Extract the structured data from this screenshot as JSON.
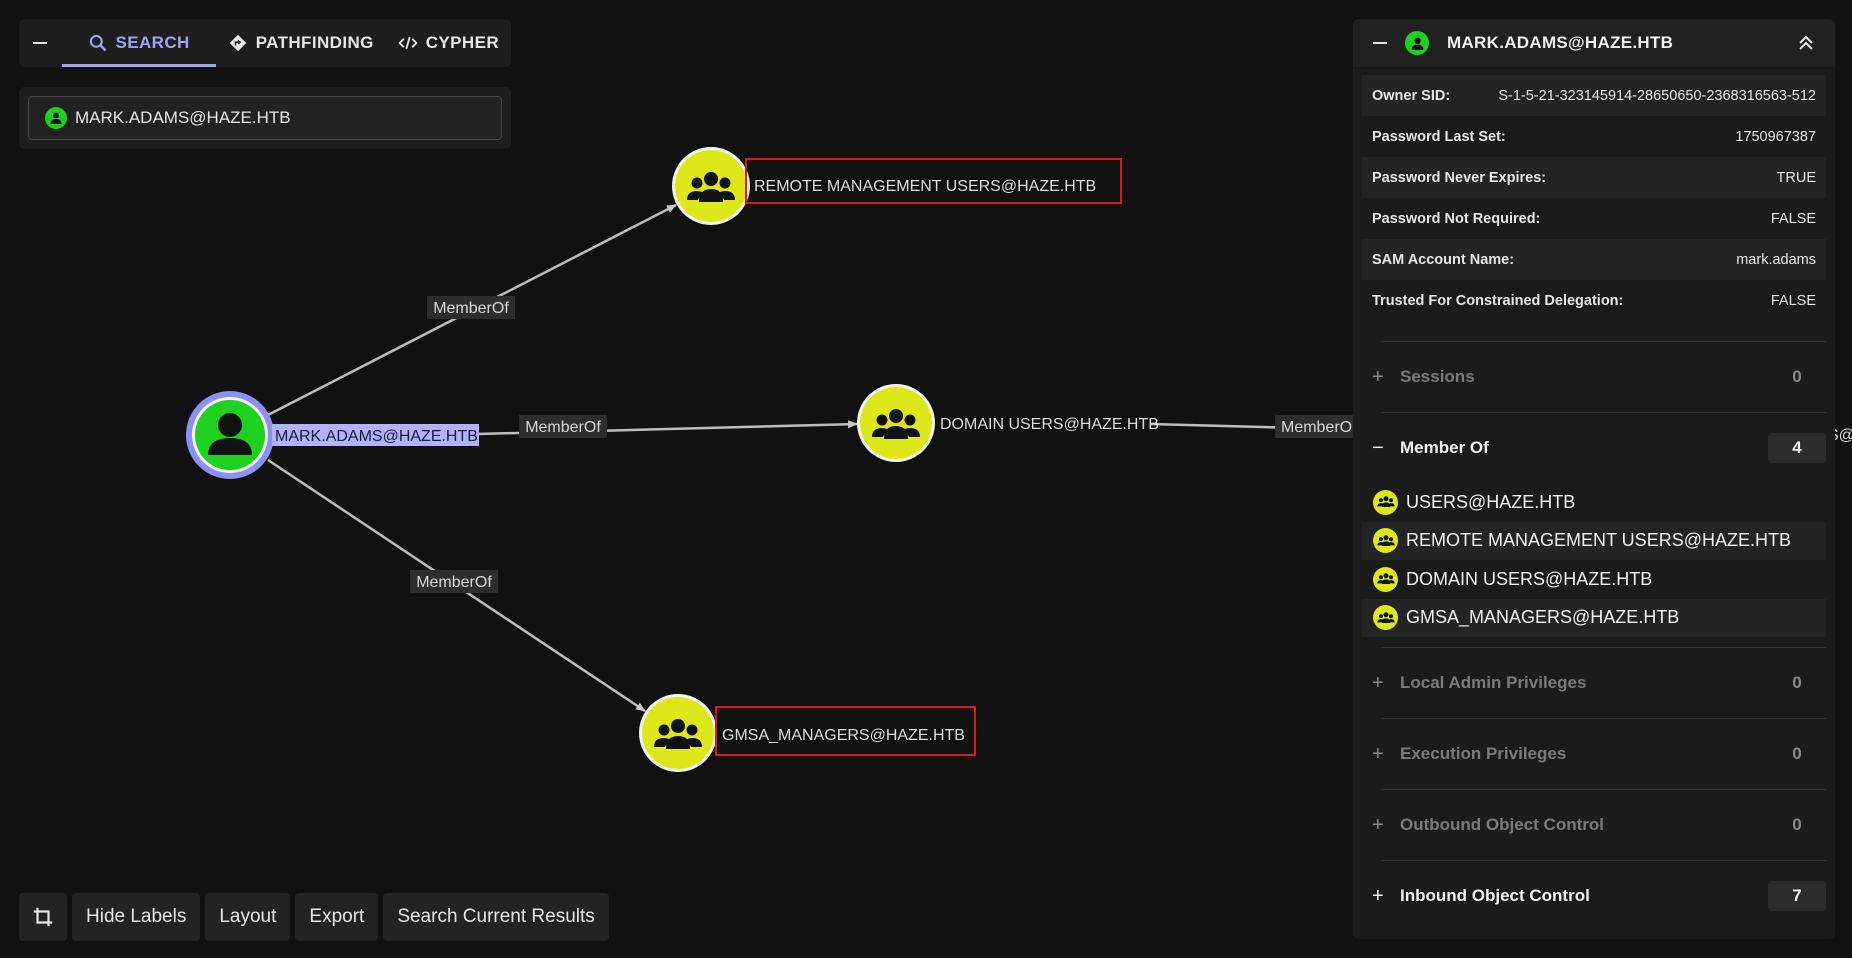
{
  "search_panel": {
    "tabs": [
      {
        "label": "SEARCH",
        "icon": "search-icon",
        "active": true
      },
      {
        "label": "PATHFINDING",
        "icon": "diamond-route-icon",
        "active": false
      },
      {
        "label": "CYPHER",
        "icon": "code-icon",
        "active": false
      }
    ],
    "selected_node": "MARK.ADAMS@HAZE.HTB"
  },
  "graph": {
    "nodes": {
      "user": "MARK.ADAMS@HAZE.HTB",
      "remote": "REMOTE MANAGEMENT USERS@HAZE.HTB",
      "domain": "DOMAIN USERS@HAZE.HTB",
      "gmsa": "GMSA_MANAGERS@HAZE.HTB",
      "offscreen_partial": "S@"
    },
    "edges": {
      "e1": "MemberOf",
      "e2": "MemberOf",
      "e3": "MemberOf",
      "e4": "MemberO"
    },
    "colors": {
      "user_node": "#1fd11f",
      "user_ring": "#8b90f2",
      "group_node": "#dde81a",
      "highlight_box": "#d91a1a",
      "selected_label_bg": "#aeb3fb"
    }
  },
  "toolbar": {
    "crop_icon": "crop-icon",
    "hide_labels": "Hide Labels",
    "layout": "Layout",
    "export": "Export",
    "search_current": "Search Current Results"
  },
  "right_panel": {
    "title": "MARK.ADAMS@HAZE.HTB",
    "properties": [
      {
        "key": "Owner SID:",
        "value": "S-1-5-21-323145914-28650650-2368316563-512"
      },
      {
        "key": "Password Last Set:",
        "value": "1750967387"
      },
      {
        "key": "Password Never Expires:",
        "value": "TRUE"
      },
      {
        "key": "Password Not Required:",
        "value": "FALSE"
      },
      {
        "key": "SAM Account Name:",
        "value": "mark.adams"
      },
      {
        "key": "Trusted For Constrained Delegation:",
        "value": "FALSE"
      }
    ],
    "sections": {
      "sessions": {
        "label": "Sessions",
        "count": "0"
      },
      "member_of": {
        "label": "Member Of",
        "count": "4",
        "items": [
          "USERS@HAZE.HTB",
          "REMOTE MANAGEMENT USERS@HAZE.HTB",
          "DOMAIN USERS@HAZE.HTB",
          "GMSA_MANAGERS@HAZE.HTB"
        ]
      },
      "local_admin": {
        "label": "Local Admin Privileges",
        "count": "0"
      },
      "execution": {
        "label": "Execution Privileges",
        "count": "0"
      },
      "outbound": {
        "label": "Outbound Object Control",
        "count": "0"
      },
      "inbound": {
        "label": "Inbound Object Control",
        "count": "7"
      }
    }
  }
}
